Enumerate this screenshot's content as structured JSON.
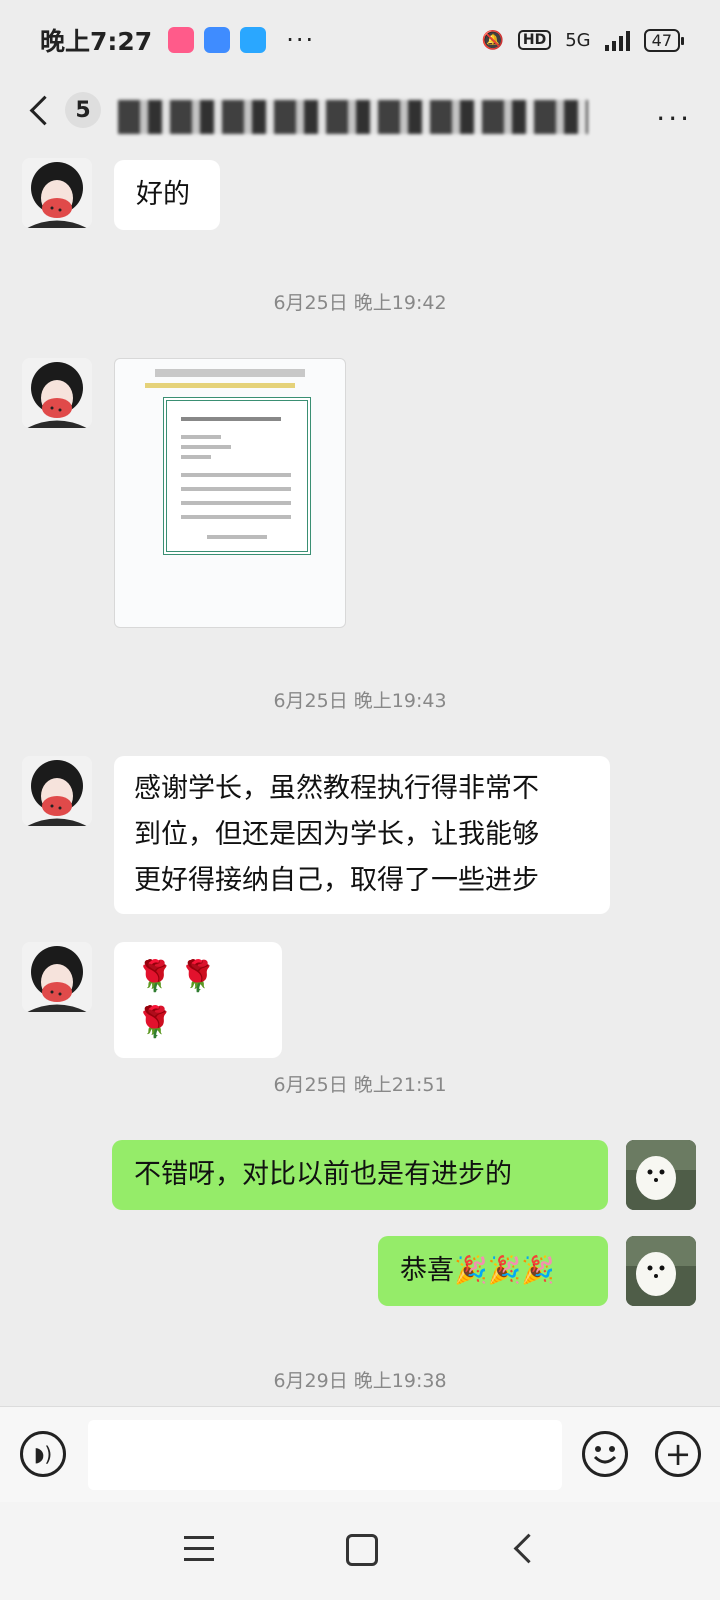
{
  "status_bar": {
    "time": "晚上7:27",
    "network": "5G",
    "hd": "HD",
    "battery": "47",
    "more": "···"
  },
  "title_bar": {
    "unread_count": "5",
    "more": "···"
  },
  "messages": [
    {
      "side": "left",
      "type": "text",
      "text": "好的"
    },
    {
      "type": "timestamp",
      "text": "6月25日 晚上19:42"
    },
    {
      "side": "left",
      "type": "image"
    },
    {
      "type": "timestamp",
      "text": "6月25日 晚上19:43"
    },
    {
      "side": "left",
      "type": "text",
      "lines": [
        "感谢学长，虽然教程执行得非常不",
        "到位，但还是因为学长，让我能够",
        "更好得接纳自己，取得了一些进步"
      ]
    },
    {
      "side": "left",
      "type": "emoji",
      "text": "🌹🌹🌹"
    },
    {
      "type": "timestamp",
      "text": "6月25日 晚上21:51"
    },
    {
      "side": "right",
      "type": "text",
      "text": "不错呀，对比以前也是有进步的"
    },
    {
      "side": "right",
      "type": "text",
      "text": "恭喜🎉🎉🎉"
    },
    {
      "type": "timestamp",
      "text": "6月29日 晚上19:38"
    }
  ],
  "colors": {
    "background": "#ededed",
    "sent_bubble": "#95ec69",
    "received_bubble": "#ffffff"
  },
  "icons": [
    "voice-icon",
    "emoji-icon",
    "plus-icon",
    "back-icon"
  ]
}
